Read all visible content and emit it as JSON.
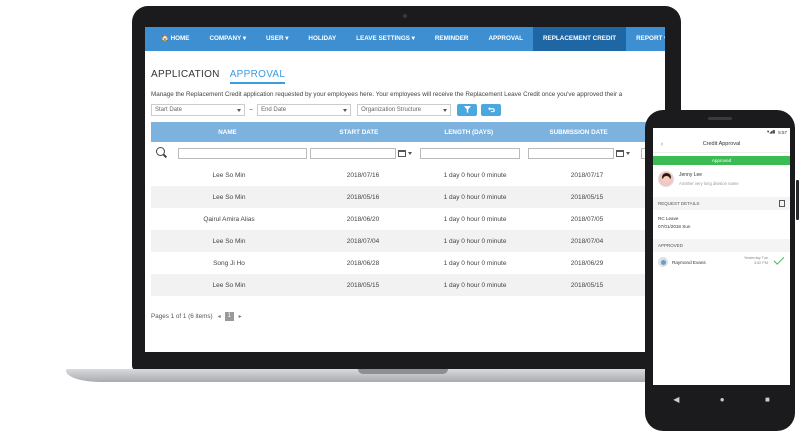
{
  "laptop": {
    "nav": {
      "items": [
        {
          "label": "🏠 HOME"
        },
        {
          "label": "COMPANY ▾"
        },
        {
          "label": "USER ▾"
        },
        {
          "label": "HOLIDAY"
        },
        {
          "label": "LEAVE SETTINGS ▾"
        },
        {
          "label": "REMINDER"
        },
        {
          "label": "APPROVAL"
        },
        {
          "label": "REPLACEMENT CREDIT"
        },
        {
          "label": "REPORT ▾"
        }
      ],
      "active_index": 7
    },
    "tabs": [
      {
        "label": "APPLICATION"
      },
      {
        "label": "APPROVAL"
      }
    ],
    "description": "Manage the Replacement Credit application requested by your employees here. Your employees will receive the Replacement Leave Credit once you've approved their a",
    "filters": {
      "start_date": "Start Date",
      "separator": "~",
      "end_date": "End Date",
      "org_structure": "Organization Structure"
    },
    "table": {
      "headers": [
        "NAME",
        "START DATE",
        "LENGTH (DAYS)",
        "SUBMISSION DATE"
      ],
      "rows": [
        {
          "name": "Lee So Min",
          "start": "2018/07/16",
          "length": "1 day 0 hour 0 minute",
          "submitted": "2018/07/17"
        },
        {
          "name": "Lee So Min",
          "start": "2018/05/16",
          "length": "1 day 0 hour 0 minute",
          "submitted": "2018/05/15"
        },
        {
          "name": "Qairul Amira Alias",
          "start": "2018/06/20",
          "length": "1 day 0 hour 0 minute",
          "submitted": "2018/07/05"
        },
        {
          "name": "Lee So Min",
          "start": "2018/07/04",
          "length": "1 day 0 hour 0 minute",
          "submitted": "2018/07/04"
        },
        {
          "name": "Song Ji Ho",
          "start": "2018/06/28",
          "length": "1 day 0 hour 0 minute",
          "submitted": "2018/06/29"
        },
        {
          "name": "Lee So Min",
          "start": "2018/05/15",
          "length": "1 day 0 hour 0 minute",
          "submitted": "2018/05/15"
        }
      ]
    },
    "pager": {
      "text": "Pages 1 of 1 (6 items)",
      "prev": "◂",
      "page": "1",
      "next": "▸"
    }
  },
  "phone": {
    "status_time": "5:57",
    "title": "Credit Approval",
    "back_icon": "‹",
    "status_bar": "Approved",
    "user_name": "Jenny Lee",
    "user_division": "Another very long division name",
    "request_details_label": "REQUEST DETAILS",
    "request_type": "RC Leave",
    "request_date": "07/01/2018 Sun",
    "approved_label": "APPROVED",
    "approver_name": "Raymond Evans",
    "approver_time": "Yesterday Tue 3:52 PM"
  },
  "colors": {
    "nav_bg": "#3d8fd1",
    "nav_active": "#1f66a5",
    "accent": "#3d9be0",
    "table_header": "#7db2de",
    "approved_green": "#3cba54"
  }
}
